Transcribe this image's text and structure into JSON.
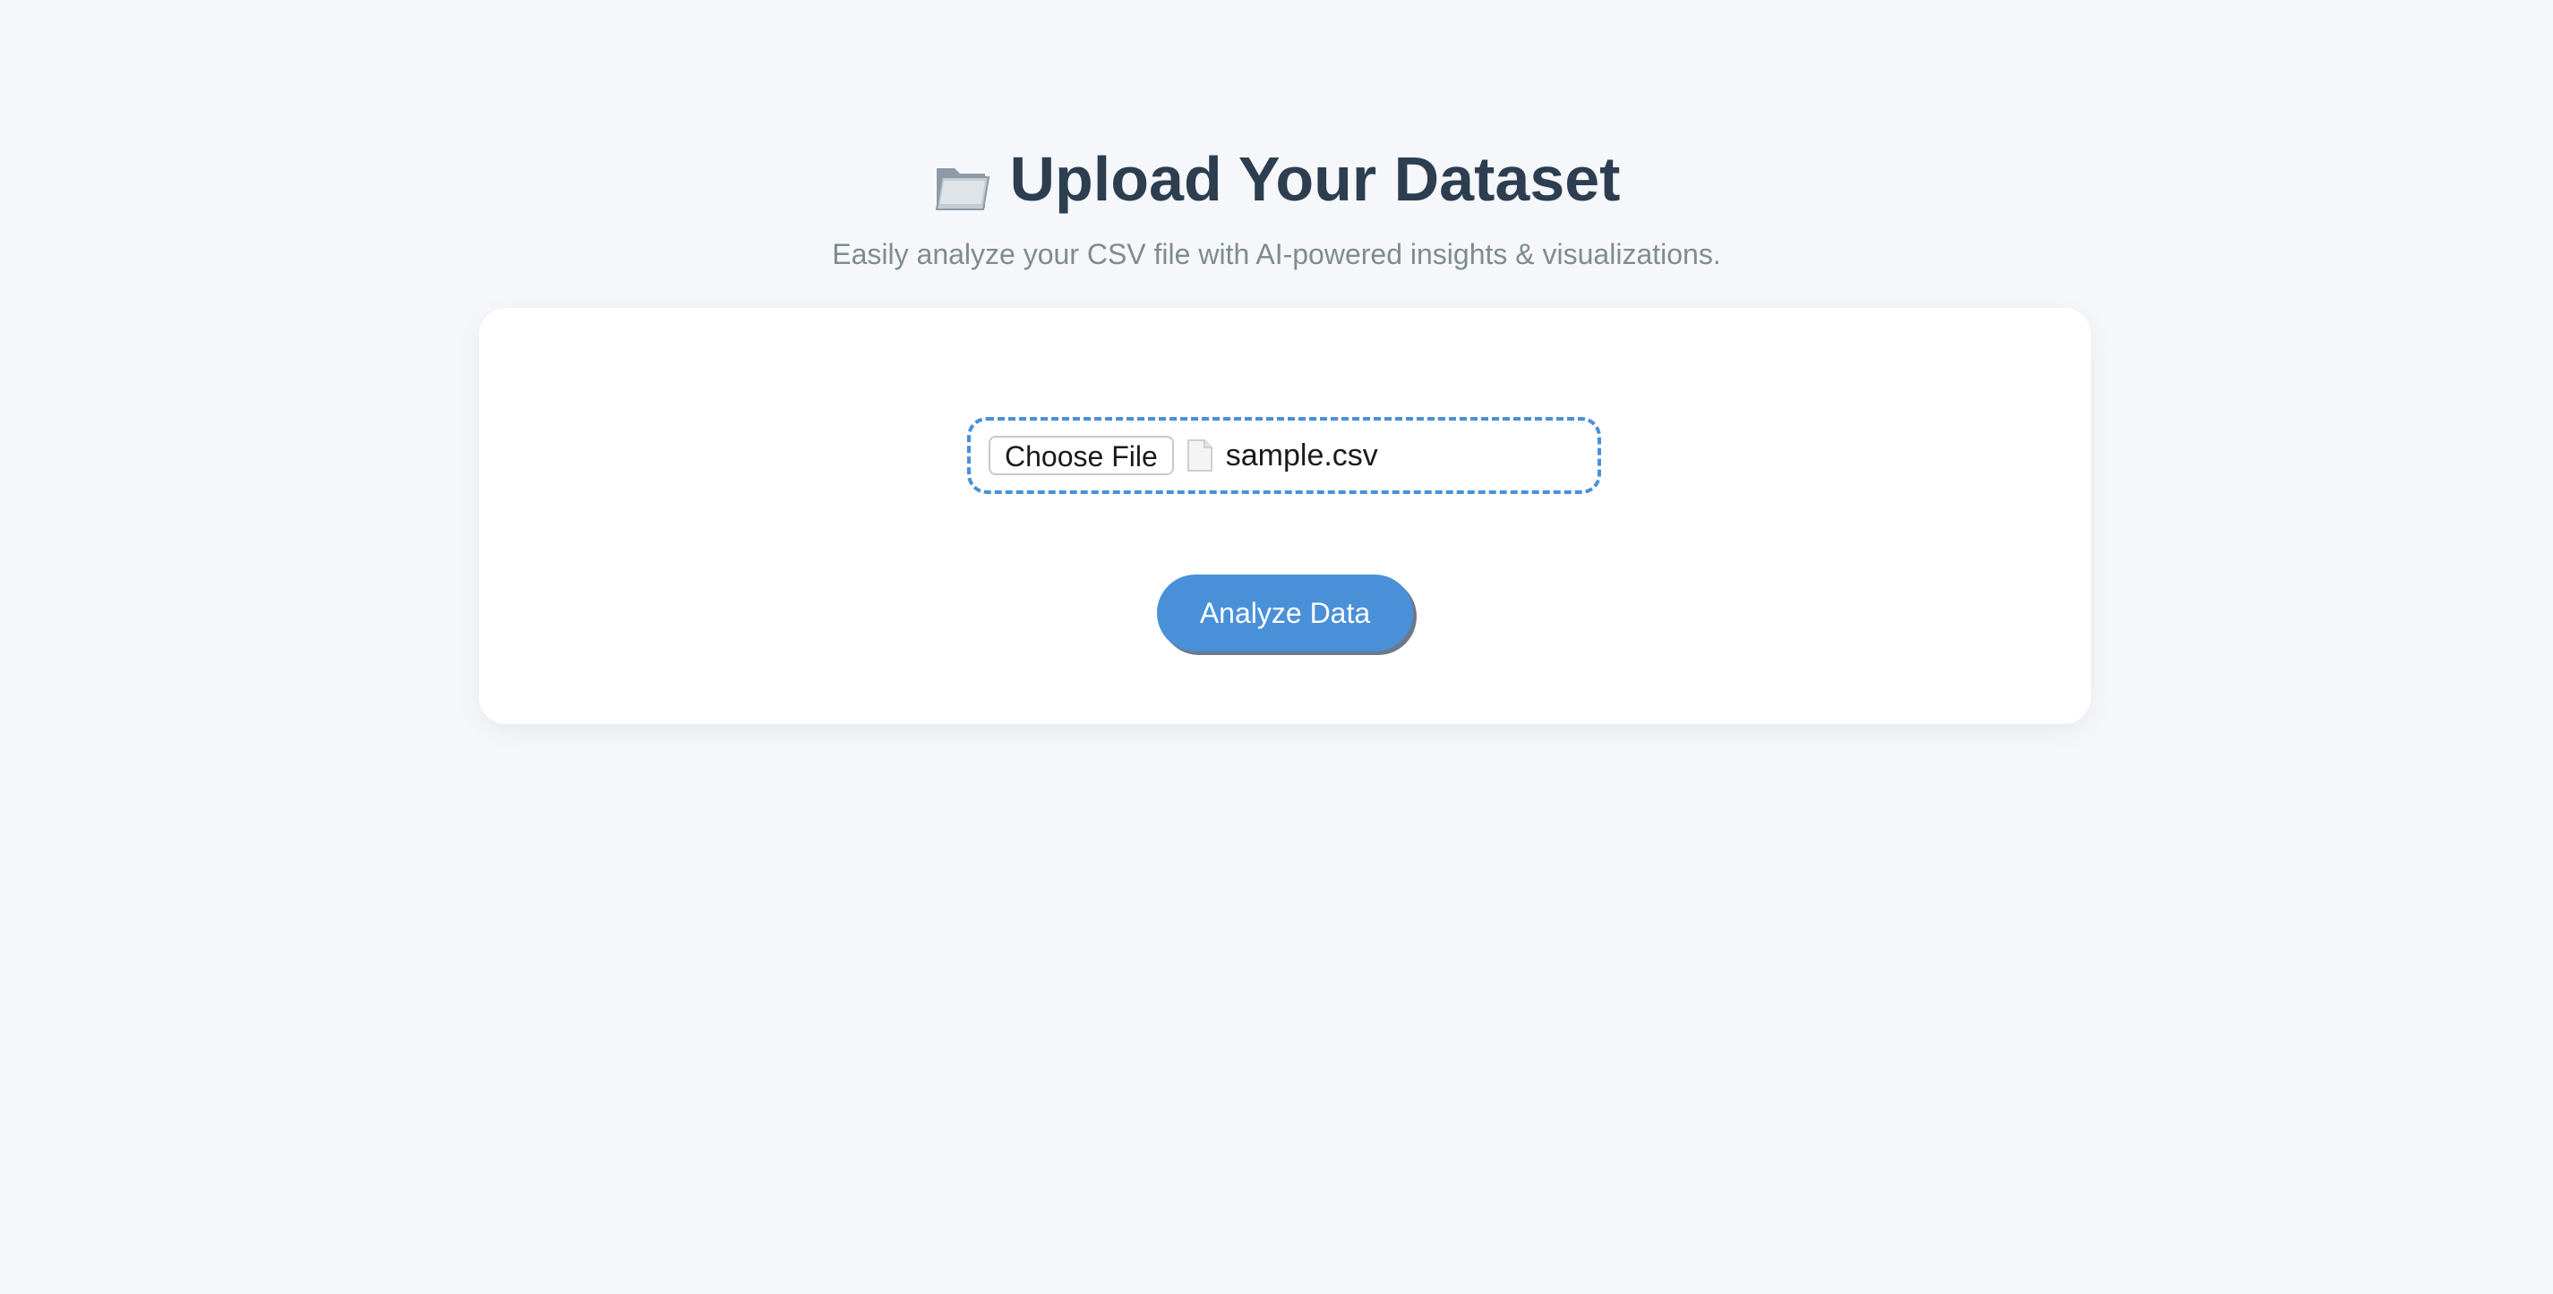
{
  "header": {
    "icon": "open-folder-icon",
    "title": "Upload Your Dataset",
    "subtitle": "Easily analyze your CSV file with AI-powered insights & visualizations."
  },
  "upload": {
    "choose_label": "Choose File",
    "file_icon": "file-icon",
    "file_name": "sample.csv"
  },
  "actions": {
    "analyze_label": "Analyze Data"
  },
  "colors": {
    "background": "#f5f7fa",
    "title": "#2c3e50",
    "subtitle": "#7f8c8d",
    "accent": "#4a90d9"
  }
}
